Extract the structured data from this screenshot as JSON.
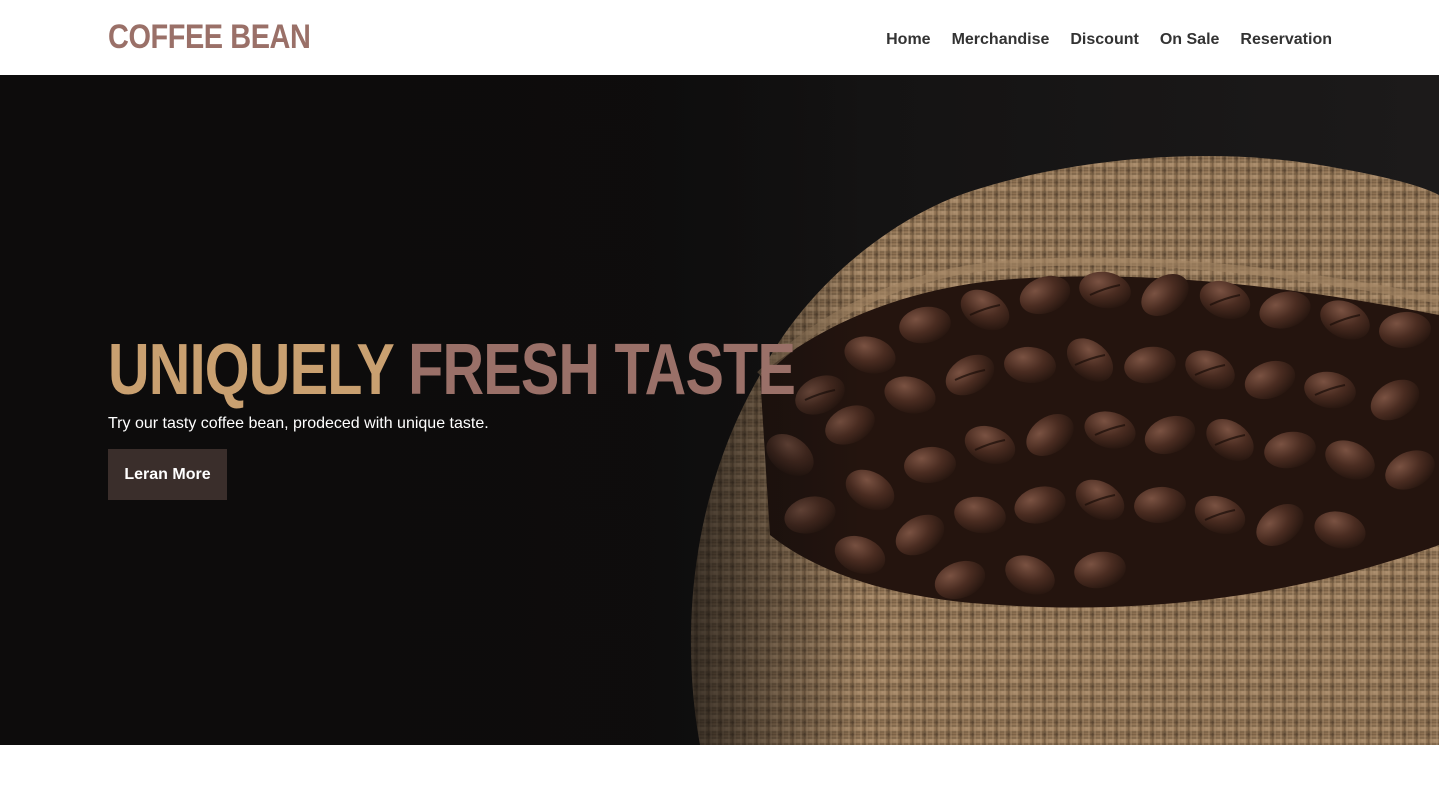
{
  "header": {
    "logo": "COFFEE BEAN",
    "nav": [
      {
        "label": "Home"
      },
      {
        "label": "Merchandise"
      },
      {
        "label": "Discount"
      },
      {
        "label": "On Sale"
      },
      {
        "label": "Reservation"
      }
    ]
  },
  "hero": {
    "title_part1": "UNIQUELY",
    "title_part2": "FRESH TASTE",
    "subtitle": "Try our tasty coffee bean, prodeced with unique taste.",
    "button_label": "Leran More"
  },
  "colors": {
    "logo": "#9a7068",
    "title_accent": "#c9a070",
    "title_secondary": "#9a7068",
    "button_bg": "#3a2e2b",
    "nav_text": "#333333"
  }
}
